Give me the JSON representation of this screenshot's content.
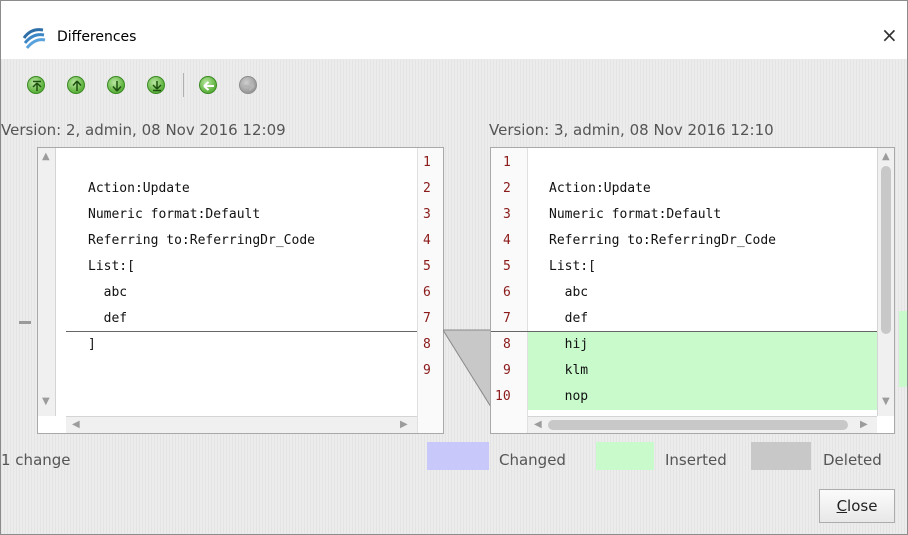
{
  "window": {
    "title": "Differences",
    "close_glyph": "×",
    "app_icon": "diff-app-icon"
  },
  "toolbar": {
    "buttons": [
      {
        "name": "first-change-button",
        "icon": "first-change-icon",
        "color": "#5bb03a"
      },
      {
        "name": "previous-change-button",
        "icon": "arrow-up-icon",
        "color": "#5bb03a"
      },
      {
        "name": "next-change-button",
        "icon": "arrow-down-icon",
        "color": "#5bb03a"
      },
      {
        "name": "last-change-button",
        "icon": "last-change-icon",
        "color": "#5bb03a"
      },
      {
        "name": "copy-to-left-button",
        "icon": "arrow-left-icon",
        "color": "#5bb03a"
      },
      {
        "name": "copy-to-right-button",
        "icon": "arrow-right-icon-disabled",
        "color": "#9a9a9a"
      }
    ]
  },
  "left": {
    "version_label": "Version: 2, admin, 08 Nov 2016 12:09",
    "lines": [
      "",
      "Action:Update",
      "Numeric format:Default",
      "Referring to:ReferringDr_Code",
      "List:[",
      "  abc",
      "  def",
      "]",
      ""
    ],
    "line_numbers": [
      "1",
      "2",
      "3",
      "4",
      "5",
      "6",
      "7",
      "8",
      "9"
    ]
  },
  "right": {
    "version_label": "Version: 3, admin, 08 Nov 2016 12:10",
    "lines": [
      "",
      "Action:Update",
      "Numeric format:Default",
      "Referring to:ReferringDr_Code",
      "List:[",
      "  abc",
      "  def",
      "  hij",
      "  klm",
      "  nop"
    ],
    "line_numbers": [
      "1",
      "2",
      "3",
      "4",
      "5",
      "6",
      "7",
      "8",
      "9",
      "10"
    ]
  },
  "status": {
    "change_count": "1 change"
  },
  "legend": {
    "changed": {
      "label": "Changed",
      "color": "#c8c8fa"
    },
    "inserted": {
      "label": "Inserted",
      "color": "#c8facc"
    },
    "deleted": {
      "label": "Deleted",
      "color": "#c8c8c8"
    }
  },
  "footer": {
    "close_label": "Close"
  }
}
